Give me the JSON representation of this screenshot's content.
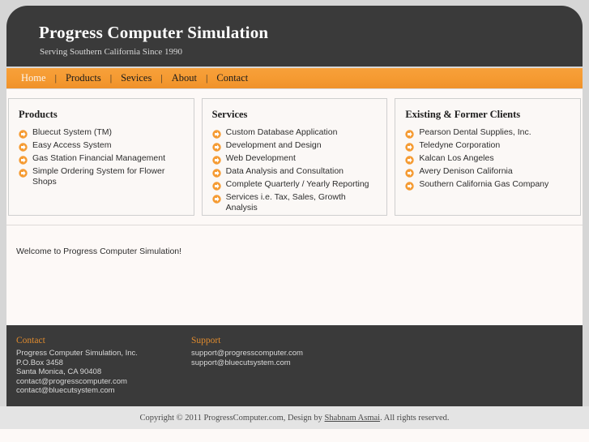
{
  "site": {
    "title": "Progress Computer Simulation",
    "tagline": "Serving Southern California Since 1990"
  },
  "nav": {
    "items": [
      {
        "label": "Home",
        "active": true
      },
      {
        "label": "Products",
        "active": false
      },
      {
        "label": "Sevices",
        "active": false
      },
      {
        "label": "About",
        "active": false
      },
      {
        "label": "Contact",
        "active": false
      }
    ],
    "separator": "|"
  },
  "panels": [
    {
      "title": "Products",
      "items": [
        "Bluecut System (TM)",
        "Easy Access System",
        "Gas Station Financial Management",
        "Simple Ordering System for Flower Shops"
      ]
    },
    {
      "title": "Services",
      "items": [
        "Custom Database Application",
        "Development and Design",
        "Web Development",
        "Data Analysis and Consultation",
        "Complete Quarterly / Yearly Reporting",
        "Services i.e. Tax, Sales, Growth Analysis"
      ]
    },
    {
      "title": "Existing & Former Clients",
      "items": [
        "Pearson Dental Supplies, Inc.",
        "Teledyne Corporation",
        "Kalcan Los Angeles",
        "Avery Denison California",
        "Southern California Gas Company"
      ]
    }
  ],
  "welcome": {
    "text": "Welcome to Progress Computer Simulation!"
  },
  "footer": {
    "contact": {
      "heading": "Contact",
      "lines": [
        "Progress Computer Simulation, Inc.",
        "P.O.Box 3458",
        "Santa Monica, CA 90408",
        "contact@progresscomputer.com",
        "contact@bluecutsystem.com"
      ]
    },
    "support": {
      "heading": "Support",
      "lines": [
        "support@progresscomputer.com",
        "support@bluecutsystem.com"
      ]
    }
  },
  "copyright": {
    "prefix": "Copyright © 2011 ProgressComputer.com, Design by ",
    "designer": "Shabnam Asmai",
    "suffix": ". All rights reserved."
  },
  "icons": {
    "bullet": "arrow-circle-right-icon"
  },
  "colors": {
    "accent": "#f59b33",
    "header_bg": "#3a3a3a",
    "page_bg": "#d6d6d6",
    "content_bg": "#fdf9f7",
    "footer_heading": "#e08b2e"
  }
}
